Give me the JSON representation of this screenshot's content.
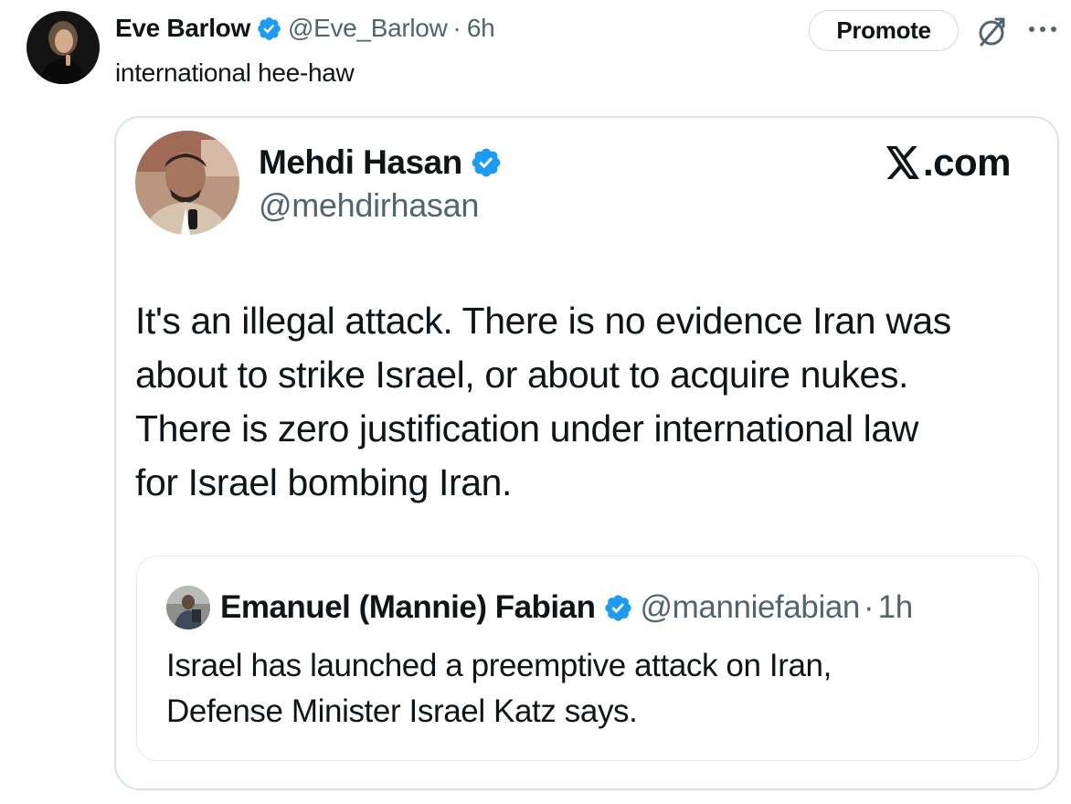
{
  "outer_tweet": {
    "author_name": "Eve Barlow",
    "author_handle": "@Eve_Barlow",
    "separator": "·",
    "time": "6h",
    "text": "international hee-haw",
    "promote_label": "Promote",
    "avatar_icon": "user-avatar",
    "analytics_icon": "analytics-icon",
    "more_icon": "more-options-icon"
  },
  "screenshot": {
    "author_name": "Mehdi Hasan",
    "author_handle": "@mehdirhasan",
    "brand_suffix": ".com",
    "brand_icon": "x-logo-icon",
    "text_lines": [
      "It's an illegal attack. There is no evidence Iran was",
      "about to strike Israel, or about to acquire nukes.",
      "There is zero justification under international law",
      "for Israel bombing Iran."
    ],
    "quoted": {
      "author_name": "Emanuel (Mannie) Fabian",
      "author_handle": "@manniefabian",
      "separator": "·",
      "time": "1h",
      "text_lines": [
        "Israel has launched a preemptive attack on Iran,",
        "Defense Minister Israel Katz says."
      ]
    }
  },
  "colors": {
    "verified_blue": "#1d9bf0",
    "secondary_text": "#536471",
    "primary_text": "#0f1419",
    "border": "#cfd9de"
  }
}
